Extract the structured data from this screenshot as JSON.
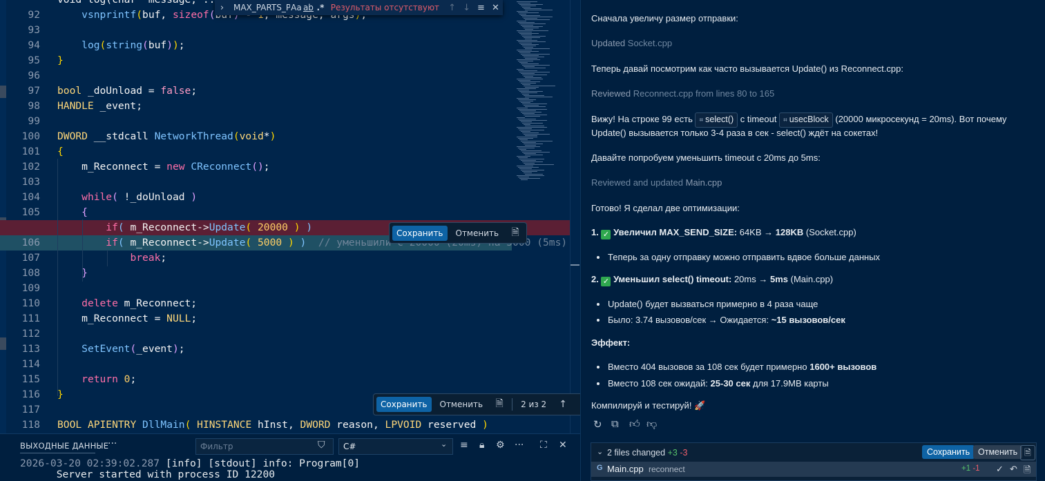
{
  "editor": {
    "find": {
      "query": "MAX_PARTS_P",
      "opt_case": "Aa",
      "opt_word": "ab",
      "opt_regex": ".*",
      "no_results": "Результаты отсутствуют"
    },
    "lines": [
      {
        "num": "",
        "segs": [
          [
            "v",
            "void log(char* message, ...)"
          ]
        ]
      },
      {
        "num": "92",
        "segs": [
          [
            "v",
            "    "
          ],
          [
            "f",
            "vsnprintf"
          ],
          [
            "br",
            "("
          ],
          [
            "v",
            "buf, "
          ],
          [
            "k",
            "sizeof"
          ],
          [
            "p",
            "("
          ],
          [
            "v",
            "buf"
          ],
          [
            "p",
            ")"
          ],
          [
            "v",
            " - "
          ],
          [
            "n",
            "1"
          ],
          [
            "v",
            ", message, args"
          ],
          [
            "br",
            ")"
          ],
          [
            "v",
            ";"
          ]
        ]
      },
      {
        "num": "93",
        "segs": []
      },
      {
        "num": "94",
        "segs": [
          [
            "v",
            "    "
          ],
          [
            "f",
            "log"
          ],
          [
            "br",
            "("
          ],
          [
            "f",
            "string"
          ],
          [
            "p",
            "("
          ],
          [
            "v",
            "buf"
          ],
          [
            "p",
            ")"
          ],
          [
            "br",
            ")"
          ],
          [
            "v",
            ";"
          ]
        ]
      },
      {
        "num": "95",
        "segs": [
          [
            "br",
            "}"
          ]
        ]
      },
      {
        "num": "96",
        "segs": []
      },
      {
        "num": "97",
        "segs": [
          [
            "t",
            "bool"
          ],
          [
            "v",
            " _doUnload = "
          ],
          [
            "bool",
            "false"
          ],
          [
            "v",
            ";"
          ]
        ]
      },
      {
        "num": "98",
        "segs": [
          [
            "t",
            "HANDLE"
          ],
          [
            "v",
            " _event;"
          ]
        ]
      },
      {
        "num": "99",
        "segs": []
      },
      {
        "num": "100",
        "segs": [
          [
            "t",
            "DWORD"
          ],
          [
            "v",
            " __stdcall "
          ],
          [
            "f",
            "NetworkThread"
          ],
          [
            "br",
            "("
          ],
          [
            "t",
            "void"
          ],
          [
            "v",
            "*"
          ],
          [
            "br",
            ")"
          ]
        ]
      },
      {
        "num": "101",
        "segs": [
          [
            "br",
            "{"
          ]
        ]
      },
      {
        "num": "102",
        "segs": [
          [
            "v",
            "    m_Reconnect = "
          ],
          [
            "k",
            "new"
          ],
          [
            "v",
            " "
          ],
          [
            "f",
            "CReconnect"
          ],
          [
            "p",
            "("
          ],
          [
            "p",
            ")"
          ],
          [
            "v",
            ";"
          ]
        ]
      },
      {
        "num": "103",
        "segs": []
      },
      {
        "num": "104",
        "segs": [
          [
            "v",
            "    "
          ],
          [
            "k",
            "while"
          ],
          [
            "p",
            "("
          ],
          [
            "v",
            " !_doUnload "
          ],
          [
            "p",
            ")"
          ]
        ]
      },
      {
        "num": "105",
        "segs": [
          [
            "v",
            "    "
          ],
          [
            "p",
            "{"
          ]
        ]
      },
      {
        "num": "",
        "bg": "del",
        "segs": [
          [
            "v",
            "        "
          ],
          [
            "k",
            "if"
          ],
          [
            "f",
            "("
          ],
          [
            "v",
            " m_Reconnect->"
          ],
          [
            "f",
            "Update"
          ],
          [
            "br",
            "("
          ],
          [
            "v",
            " "
          ],
          [
            "n",
            "20000"
          ],
          [
            "v",
            " "
          ],
          [
            "br",
            ")"
          ],
          [
            "v",
            " "
          ],
          [
            "f",
            ")"
          ]
        ]
      },
      {
        "num": "106",
        "bg": "add",
        "segs": [
          [
            "v",
            "        "
          ],
          [
            "k",
            "if"
          ],
          [
            "f",
            "("
          ],
          [
            "v",
            " m_Reconnect->"
          ],
          [
            "f",
            "Update"
          ],
          [
            "br",
            "("
          ],
          [
            "v",
            " "
          ],
          [
            "n",
            "5000"
          ],
          [
            "v",
            " "
          ],
          [
            "br",
            ")"
          ],
          [
            "v",
            " "
          ],
          [
            "f",
            ")"
          ],
          [
            "v",
            "  "
          ],
          [
            "cm",
            "// уменьшили с 20000 (20ms) на 5000 (5ms)"
          ]
        ]
      },
      {
        "num": "107",
        "segs": [
          [
            "v",
            "            "
          ],
          [
            "k",
            "break"
          ],
          [
            "v",
            ";"
          ]
        ]
      },
      {
        "num": "108",
        "segs": [
          [
            "v",
            "    "
          ],
          [
            "p",
            "}"
          ]
        ]
      },
      {
        "num": "109",
        "segs": []
      },
      {
        "num": "110",
        "segs": [
          [
            "v",
            "    "
          ],
          [
            "k",
            "delete"
          ],
          [
            "v",
            " m_Reconnect;"
          ]
        ]
      },
      {
        "num": "111",
        "segs": [
          [
            "v",
            "    m_Reconnect = "
          ],
          [
            "t",
            "NULL"
          ],
          [
            "v",
            ";"
          ]
        ]
      },
      {
        "num": "112",
        "segs": []
      },
      {
        "num": "113",
        "segs": [
          [
            "v",
            "    "
          ],
          [
            "f",
            "SetEvent"
          ],
          [
            "p",
            "("
          ],
          [
            "v",
            "_event"
          ],
          [
            "p",
            ")"
          ],
          [
            "v",
            ";"
          ]
        ]
      },
      {
        "num": "114",
        "segs": []
      },
      {
        "num": "115",
        "segs": [
          [
            "v",
            "    "
          ],
          [
            "k",
            "return"
          ],
          [
            "v",
            " "
          ],
          [
            "n",
            "0"
          ],
          [
            "v",
            ";"
          ]
        ]
      },
      {
        "num": "116",
        "segs": [
          [
            "br",
            "}"
          ]
        ]
      },
      {
        "num": "117",
        "segs": []
      },
      {
        "num": "118",
        "segs": [
          [
            "t",
            "BOOL"
          ],
          [
            "v",
            " "
          ],
          [
            "t",
            "APIENTRY"
          ],
          [
            "v",
            " "
          ],
          [
            "f",
            "DllMain"
          ],
          [
            "br",
            "("
          ],
          [
            "v",
            " "
          ],
          [
            "t",
            "HINSTANCE"
          ],
          [
            "v",
            " hInst, "
          ],
          [
            "t",
            "DWORD"
          ],
          [
            "v",
            " reason, "
          ],
          [
            "t",
            "LPVOID"
          ],
          [
            "v",
            " reserved "
          ],
          [
            "br",
            ")"
          ]
        ]
      }
    ],
    "inline_bar": {
      "keep": "Сохранить",
      "undo": "Отменить"
    },
    "bottom_bar": {
      "keep": "Сохранить",
      "undo": "Отменить",
      "counter": "2 из 2"
    }
  },
  "panel": {
    "title": "ВЫХОДНЫЕ ДАННЫЕ",
    "filter_placeholder": "Фильтр",
    "channel": "C#",
    "lines": [
      {
        "ts": "2026-03-20 02:39:02.287",
        "text": " [info] [stdout] info: Program[0]"
      },
      {
        "ts": "",
        "text": "      Server started with process ID 12200"
      }
    ]
  },
  "chat": {
    "p1": "Сначала увеличу размер отправки:",
    "p2_label": "Updated",
    "p2_file": "Socket.cpp",
    "p3": "Теперь давай посмотрим как часто вызывается Update() из Reconnect.cpp:",
    "p4_label": "Reviewed",
    "p4_file": "Reconnect.cpp from lines 80 to 165",
    "p5_a": "Вижу! На строке 99 есть",
    "p5_chip1": "select()",
    "p5_b": "с timeout",
    "p5_chip2": "usecBlock",
    "p5_c": "(20000 микросекунд = 20ms). Вот почему",
    "p5_d": "Update() вызывается только 3-4 раза в сек - select() ждёт на сокетах!",
    "p6": "Давайте попробуем уменьшить timeout с 20ms до 5ms:",
    "p7_label": "Reviewed and updated",
    "p7_file": "Main.cpp",
    "p8": "Готово! Я сделал две оптимизации:",
    "opt1_num": "1.",
    "opt1_bold": "Увеличил MAX_SEND_SIZE:",
    "opt1_from": "64KB →",
    "opt1_to": "128KB",
    "opt1_file": "(Socket.cpp)",
    "opt1_b1": "Теперь за одну отправку можно отправить вдвое больше данных",
    "opt2_num": "2.",
    "opt2_bold": "Уменьшил select() timeout:",
    "opt2_from": "20ms →",
    "opt2_to": "5ms",
    "opt2_file": "(Main.cpp)",
    "opt2_b1": "Update() будет вызваться примерно в 4 раза чаще",
    "opt2_b2_a": "Было: 3.74 вызовов/сек → Ожидается:",
    "opt2_b2_b": "~15 вызовов/сек",
    "effect_title": "Эффект:",
    "eff_b1_a": "Вместо 404 вызовов за 108 сек будет примерно",
    "eff_b1_b": "1600+ вызовов",
    "eff_b2_a": "Вместо 108 сек ожидай:",
    "eff_b2_b": "25-30 сек",
    "eff_b2_c": "для 17.9MB карты",
    "final": "Компилируй и тестируй! 🚀",
    "changes": {
      "summary": "2 files changed",
      "plus": "+3",
      "minus": "-3",
      "keep": "Сохранить",
      "undo": "Отменить",
      "file_name": "Main.cpp",
      "file_dir": "reconnect",
      "file_plus": "+1",
      "file_minus": "-1"
    }
  },
  "colors": {
    "accent": "#0e63a5",
    "deleted_line": "#5b1f34",
    "added_line": "#1f5064",
    "editor_bg": "#00254b"
  }
}
